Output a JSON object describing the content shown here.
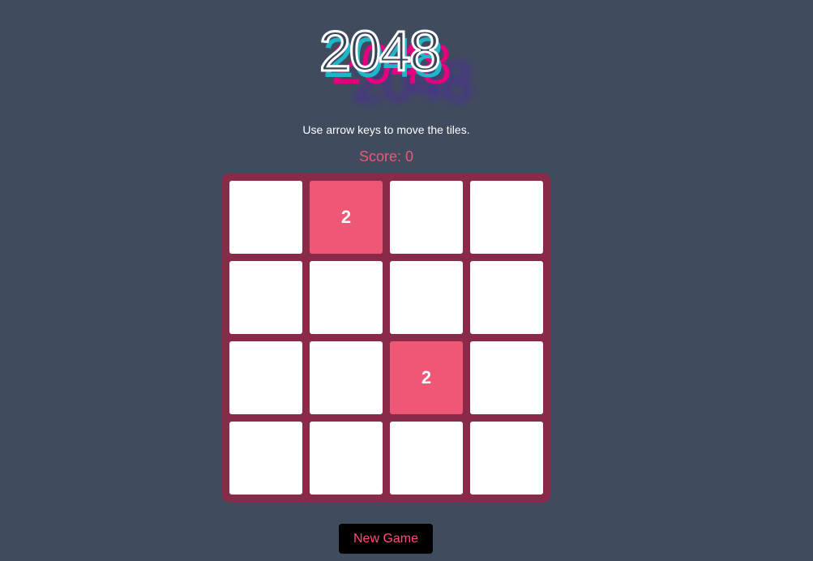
{
  "logo": {
    "text": "2048"
  },
  "instructions": "Use arrow keys to move the tiles.",
  "score_label": "Score: 0",
  "board": {
    "rows": [
      [
        "",
        "2",
        "",
        ""
      ],
      [
        "",
        "",
        "",
        ""
      ],
      [
        "",
        "",
        "2",
        ""
      ],
      [
        "",
        "",
        "",
        ""
      ]
    ]
  },
  "new_game_label": "New Game",
  "colors": {
    "background": "#414b5e",
    "board": "#8a2a49",
    "tile_empty": "#ffffff",
    "tile_2": "#ef5777",
    "accent": "#ef5777",
    "button_bg": "#000000",
    "button_text": "#ff4d7a"
  }
}
